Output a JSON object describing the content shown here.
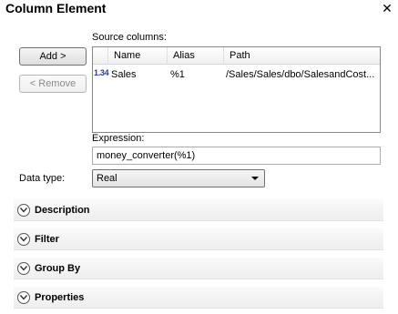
{
  "dialog": {
    "title": "Column Element",
    "close_icon": "close-icon"
  },
  "buttons": {
    "add": "Add >",
    "remove": "< Remove"
  },
  "source_columns": {
    "label": "Source columns:",
    "headers": [
      "Name",
      "Alias",
      "Path"
    ],
    "rows": [
      {
        "type_icon": "1.34",
        "name": "Sales",
        "alias": "%1",
        "path": "/Sales/Sales/dbo/SalesandCost..."
      }
    ]
  },
  "expression": {
    "label": "Expression:",
    "value": "money_converter(%1)"
  },
  "data_type": {
    "label": "Data type:",
    "value": "Real"
  },
  "sections": [
    "Description",
    "Filter",
    "Group By",
    "Properties"
  ]
}
